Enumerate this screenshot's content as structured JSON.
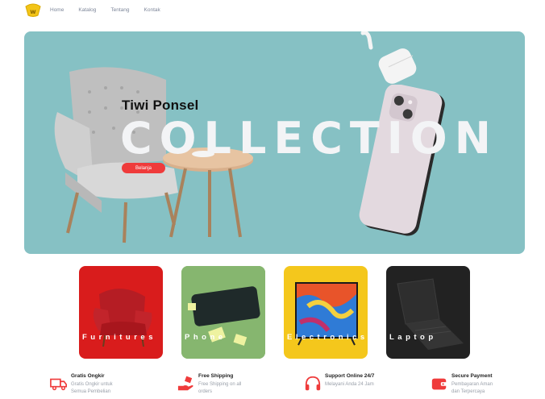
{
  "nav": {
    "logo_icon": "brand-logo",
    "links": [
      "Home",
      "Katalog",
      "Tentang",
      "Kontak"
    ]
  },
  "hero": {
    "subtitle": "Tiwi Ponsel",
    "title": "COLLECTION",
    "button_label": "Belanja",
    "background_color": "#86c1c4"
  },
  "categories": [
    {
      "label": "Furnitures",
      "color": "#d91c1c",
      "icon": "armchair-image"
    },
    {
      "label": "Phone",
      "color": "#7fb06a",
      "icon": "smartphone-image"
    },
    {
      "label": "Electronics",
      "color": "#f4c71c",
      "icon": "television-image"
    },
    {
      "label": "Laptop",
      "color": "#222222",
      "icon": "laptop-image"
    }
  ],
  "features": [
    {
      "title": "Gratis Ongkir",
      "desc": "Gratis Ongkir untuk Semua Pembelian",
      "icon": "truck-icon"
    },
    {
      "title": "Free Shipping",
      "desc": "Free Shipping on all orders",
      "icon": "hand-package-icon"
    },
    {
      "title": "Support Online 24/7",
      "desc": "Melayani Anda 24 Jam",
      "icon": "headset-icon"
    },
    {
      "title": "Secure Payment",
      "desc": "Pembayaran Aman dan Terpercaya",
      "icon": "wallet-icon"
    }
  ],
  "colors": {
    "accent": "#ef3b3b",
    "nav_text": "#7d8699"
  }
}
